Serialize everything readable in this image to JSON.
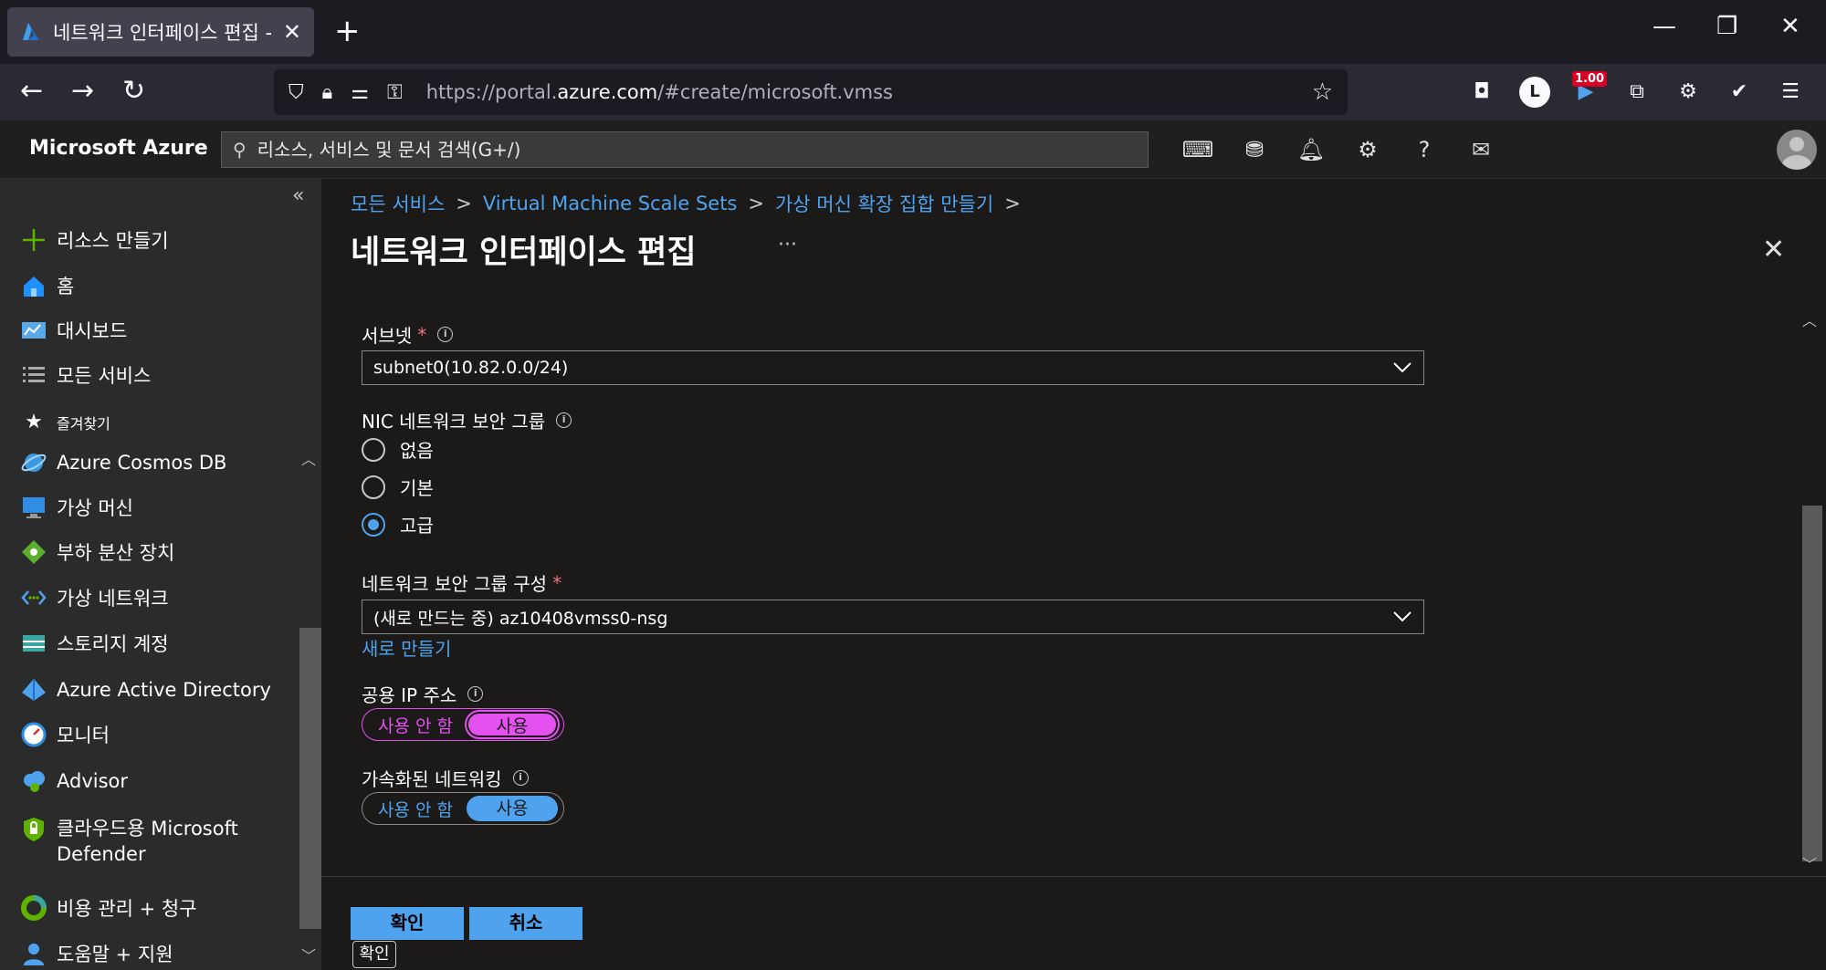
{
  "browser": {
    "tab_title": "네트워크 인터페이스 편집 - Mi",
    "url_prefix": "https://portal.",
    "url_host": "azure.com",
    "url_path": "/#create/microsoft.vmss",
    "ext_badge": "1.00",
    "ext_l": "L"
  },
  "azure": {
    "brand": "Microsoft Azure",
    "search_placeholder": "리소스, 서비스 및 문서 검색(G+/)"
  },
  "sidebar": {
    "create": "리소스 만들기",
    "home": "홈",
    "dashboard": "대시보드",
    "all_services": "모든 서비스",
    "favorites": "즐겨찾기",
    "items": [
      {
        "label": "Azure Cosmos DB"
      },
      {
        "label": "가상 머신"
      },
      {
        "label": "부하 분산 장치"
      },
      {
        "label": "가상 네트워크"
      },
      {
        "label": "스토리지 계정"
      },
      {
        "label": "Azure Active Directory"
      },
      {
        "label": "모니터"
      },
      {
        "label": "Advisor"
      },
      {
        "label": "클라우드용 Microsoft"
      },
      {
        "label": "Defender"
      },
      {
        "label": "비용 관리 + 청구"
      },
      {
        "label": "도움말 + 지원"
      }
    ]
  },
  "breadcrumb": [
    "모든 서비스",
    "Virtual Machine Scale Sets",
    "가상 머신 확장 집합 만들기"
  ],
  "page_title": "네트워크 인터페이스 편집",
  "form": {
    "subnet_label": "서브넷",
    "subnet_value": "subnet0(10.82.0.0/24)",
    "nic_nsg_label": "NIC 네트워크 보안 그룹",
    "nic_options": [
      "없음",
      "기본",
      "고급"
    ],
    "nic_selected": "고급",
    "nsg_config_label": "네트워크 보안 그룹 구성",
    "nsg_config_value": "(새로 만드는 중) az10408vmss0-nsg",
    "create_new": "새로 만들기",
    "public_ip_label": "공용 IP 주소",
    "public_ip_off": "사용 안 함",
    "public_ip_on": "사용",
    "public_ip_selected": "사용",
    "accel_label": "가속화된 네트워킹",
    "accel_off": "사용 안 함",
    "accel_on": "사용",
    "accel_selected": "사용"
  },
  "buttons": {
    "ok": "확인",
    "cancel": "취소",
    "tooltip": "확인"
  },
  "colors": {
    "accent": "#4fa3ee",
    "highlight_toggle": "#e550f0",
    "required": "#f1707b"
  }
}
